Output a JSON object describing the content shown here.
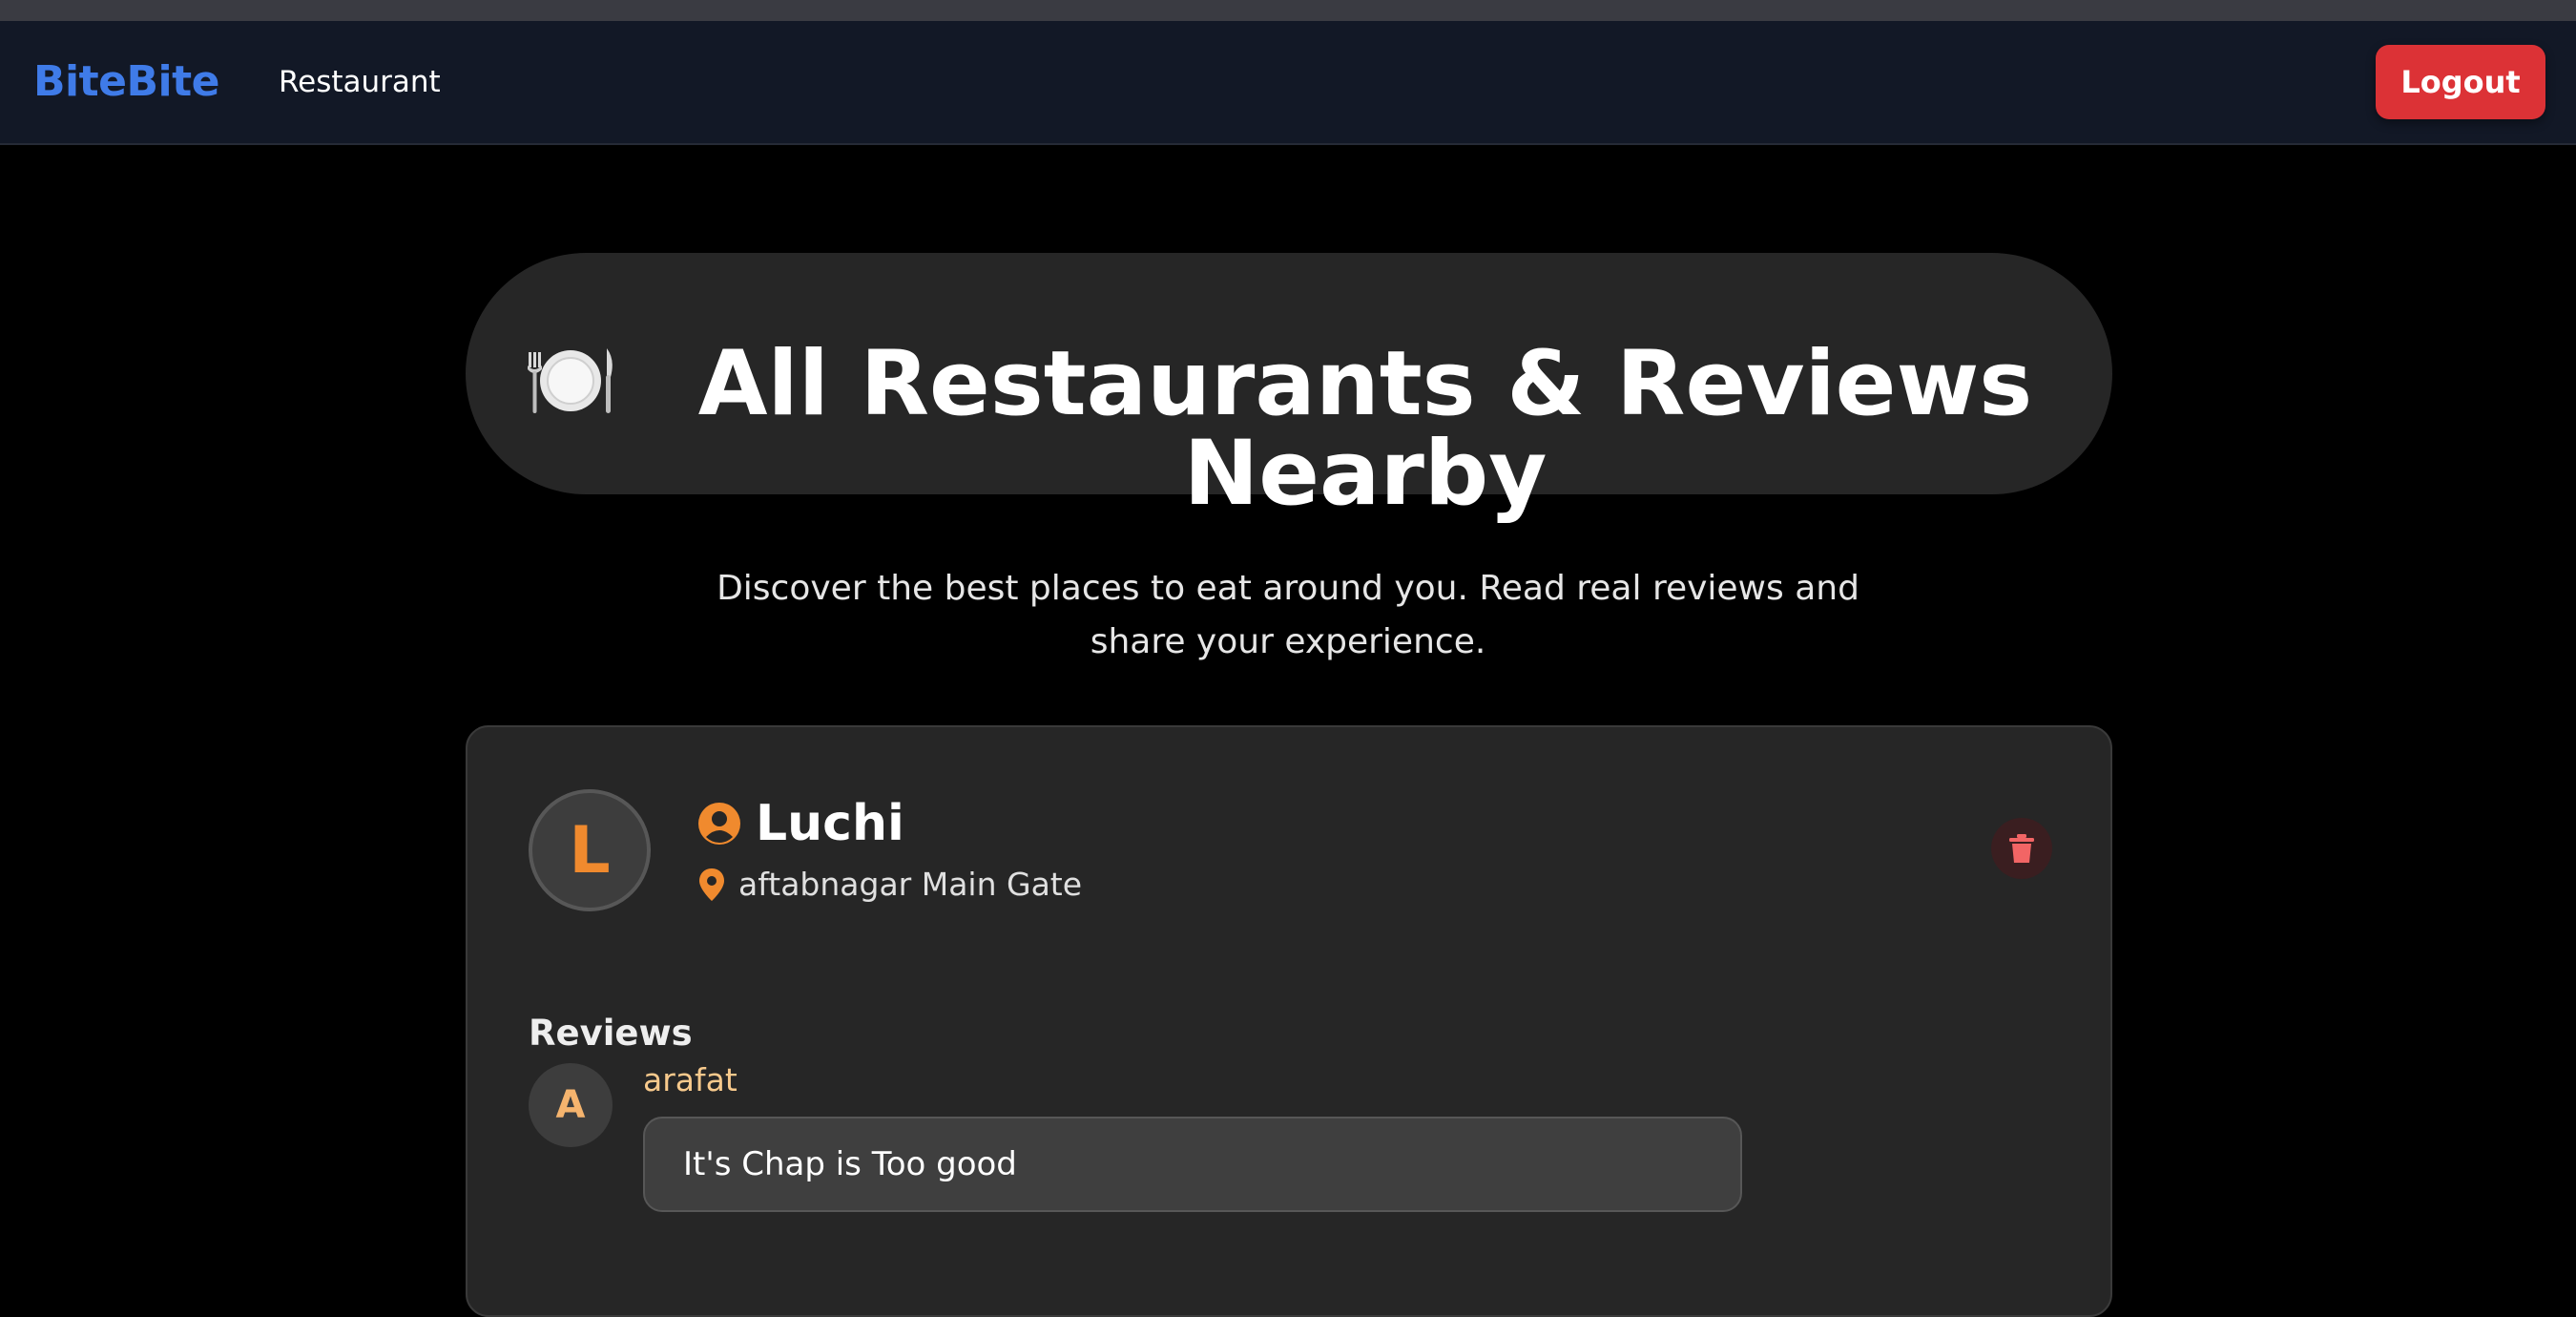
{
  "navbar": {
    "brand": "BiteBite",
    "link_restaurant": "Restaurant",
    "logout_label": "Logout"
  },
  "hero": {
    "icon": "plate-with-cutlery-icon",
    "title": "All Restaurants & Reviews Nearby",
    "subtitle": "Discover the best places to eat around you. Read real reviews and share your experience."
  },
  "restaurants": [
    {
      "avatar_letter": "L",
      "name": "Luchi",
      "name_icon": "user-circle-icon",
      "location": "aftabnagar Main Gate",
      "location_icon": "map-pin-icon",
      "delete_icon": "trash-icon",
      "reviews_heading": "Reviews",
      "reviews": [
        {
          "avatar_letter": "A",
          "author": "arafat",
          "text": "It's Chap is Too good"
        }
      ]
    }
  ],
  "colors": {
    "brand": "#3f7be8",
    "accent_orange": "#f08a2e",
    "logout_red": "#dc3236",
    "navbar_bg": "#121826",
    "card_bg": "#262626"
  }
}
